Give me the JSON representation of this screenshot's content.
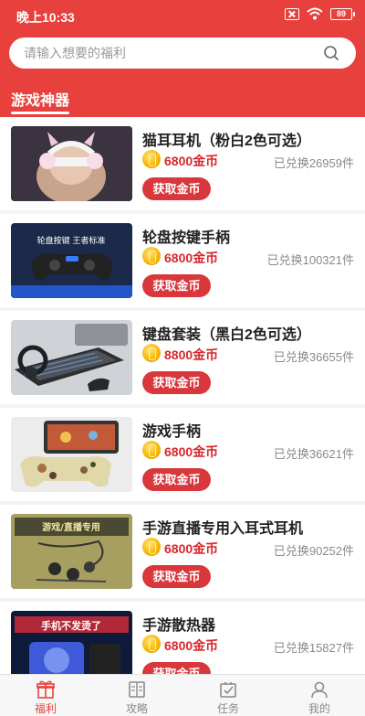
{
  "status": {
    "time": "晚上10:33",
    "battery": "89"
  },
  "search": {
    "placeholder": "请输入想要的福利"
  },
  "section": {
    "title": "游戏神器"
  },
  "items": [
    {
      "title": "猫耳耳机（粉白2色可选）",
      "price": "6800金币",
      "sold": "已兑换26959件",
      "button": "获取金币",
      "thumb_label": ""
    },
    {
      "title": "轮盘按键手柄",
      "price": "6800金币",
      "sold": "已兑换100321件",
      "button": "获取金币",
      "thumb_label": "轮盘按键 王者标准"
    },
    {
      "title": "键盘套装（黑白2色可选）",
      "price": "8800金币",
      "sold": "已兑换36655件",
      "button": "获取金币",
      "thumb_label": ""
    },
    {
      "title": "游戏手柄",
      "price": "6800金币",
      "sold": "已兑换36621件",
      "button": "获取金币",
      "thumb_label": ""
    },
    {
      "title": "手游直播专用入耳式耳机",
      "price": "6800金币",
      "sold": "已兑换90252件",
      "button": "获取金币",
      "thumb_label": "游戏/直播专用"
    },
    {
      "title": "手游散热器",
      "price": "6800金币",
      "sold": "已兑换15827件",
      "button": "获取金币",
      "thumb_label": "手机不发烫了"
    }
  ],
  "tabbar": {
    "tabs": [
      {
        "label": "福利",
        "icon": "gift-icon",
        "active": true
      },
      {
        "label": "攻略",
        "icon": "book-icon",
        "active": false
      },
      {
        "label": "任务",
        "icon": "task-icon",
        "active": false
      },
      {
        "label": "我的",
        "icon": "user-icon",
        "active": false
      }
    ]
  },
  "colors": {
    "brand": "#e8413d",
    "price": "#d8272c",
    "button": "#d8373c"
  }
}
